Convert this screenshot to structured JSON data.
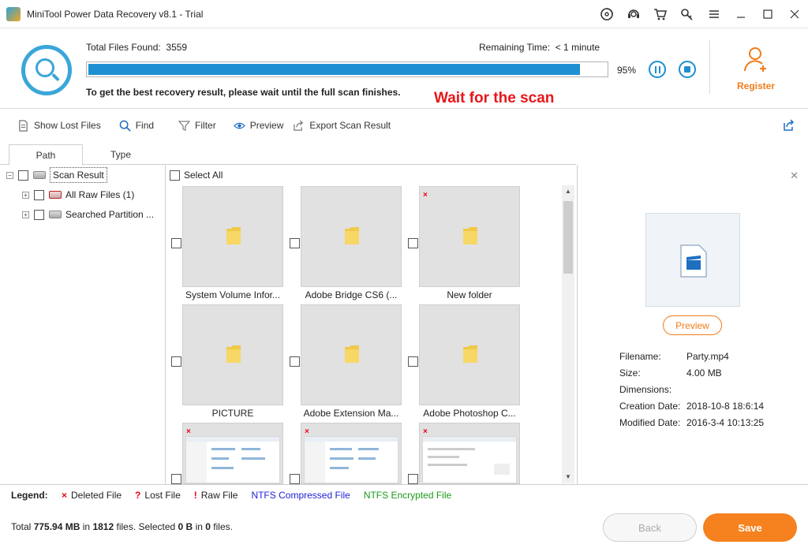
{
  "window": {
    "title": "MiniTool Power Data Recovery v8.1 - Trial"
  },
  "scan": {
    "files_found_label": "Total Files Found:",
    "files_found_value": "3559",
    "remaining_label": "Remaining Time:",
    "remaining_value": "< 1 minute",
    "progress_percent": 95,
    "percent_text": "95%",
    "hint": "To get the best recovery result, please wait until the full scan finishes.",
    "annotation": "Wait for the scan"
  },
  "register": {
    "label": "Register"
  },
  "toolbar": {
    "show_lost_files": "Show Lost Files",
    "find": "Find",
    "filter": "Filter",
    "preview": "Preview",
    "export_scan_result": "Export Scan Result"
  },
  "tabs": {
    "path": "Path",
    "type": "Type"
  },
  "tree": {
    "root": "Scan Result",
    "raw_files": "All Raw Files (1)",
    "searched_partition": "Searched Partition ..."
  },
  "grid": {
    "select_all": "Select All",
    "items": [
      {
        "label": "System Volume Infor...",
        "deleted": false
      },
      {
        "label": "Adobe Bridge CS6 (...",
        "deleted": false
      },
      {
        "label": "New folder",
        "deleted": true
      },
      {
        "label": "PICTURE",
        "deleted": false
      },
      {
        "label": "Adobe Extension Ma...",
        "deleted": false
      },
      {
        "label": "Adobe Photoshop C...",
        "deleted": false
      }
    ]
  },
  "preview_pane": {
    "button": "Preview",
    "filename_label": "Filename:",
    "filename": "Party.mp4",
    "size_label": "Size:",
    "size": "4.00 MB",
    "dimensions_label": "Dimensions:",
    "dimensions": "",
    "created_label": "Creation Date:",
    "created": "2018-10-8 18:6:14",
    "modified_label": "Modified Date:",
    "modified": "2016-3-4 10:13:25"
  },
  "legend": {
    "title": "Legend:",
    "deleted_mark": "×",
    "deleted": "Deleted File",
    "lost_mark": "?",
    "lost": "Lost File",
    "raw_mark": "!",
    "raw": "Raw File",
    "ntfs_compressed": "NTFS Compressed File",
    "ntfs_compressed_color": "#1f1fd6",
    "ntfs_encrypted": "NTFS Encrypted File",
    "ntfs_encrypted_color": "#1a9a1a"
  },
  "footer": {
    "total_prefix": "Total",
    "total_size": "775.94 MB",
    "in1": "in",
    "total_files": "1812",
    "files1": "files.  Selected",
    "selected_size": "0 B",
    "in2": "in",
    "selected_files": "0",
    "files2": "files.",
    "back": "Back",
    "save": "Save"
  },
  "colors": {
    "accent": "#1e90d1",
    "orange": "#f5821f",
    "alert": "#e8161b"
  }
}
